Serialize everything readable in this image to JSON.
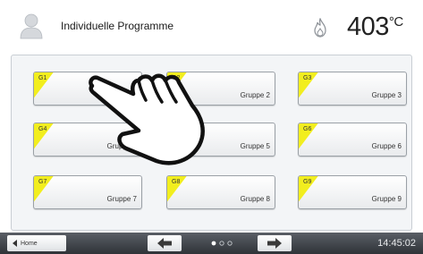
{
  "header": {
    "title": "Individuelle Programme",
    "temperature": "403",
    "temperature_unit": "°C"
  },
  "programs": [
    {
      "code": "G1",
      "name": ""
    },
    {
      "code": "G2",
      "name": "Gruppe 2"
    },
    {
      "code": "G3",
      "name": "Gruppe 3"
    },
    {
      "code": "G4",
      "name": "Gruppe 4"
    },
    {
      "code": "G5",
      "name": "Gruppe 5"
    },
    {
      "code": "G6",
      "name": "Gruppe 6"
    },
    {
      "code": "G7",
      "name": "Gruppe 7"
    },
    {
      "code": "G8",
      "name": "Gruppe 8"
    },
    {
      "code": "G9",
      "name": "Gruppe 9"
    }
  ],
  "footer": {
    "home_label": "Home",
    "time": "14:45:02",
    "page_current": 1,
    "page_total": 3
  },
  "colors": {
    "accent_yellow": "#f2ee1e",
    "footer_dark": "#3a3e44",
    "arrow": "#3a3a3a"
  },
  "icons": {
    "user": "user-icon",
    "flame": "flame-icon",
    "hand": "pointing-hand-icon",
    "prev": "arrow-left-icon",
    "next": "arrow-right-icon",
    "home": "triangle-left-icon"
  }
}
